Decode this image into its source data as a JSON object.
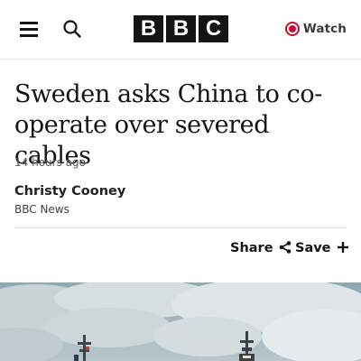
{
  "header": {
    "menu_icon": "hamburger-menu-icon",
    "search_icon": "search-icon",
    "logo_letters": [
      "B",
      "B",
      "C"
    ],
    "watch_label": "Watch",
    "watch_icon": "live-record-icon",
    "accent_color": "#c8102e"
  },
  "article": {
    "headline": "Sweden asks China to co-operate over severed cables",
    "timestamp": "14 hours ago",
    "author": {
      "name": "Christy Cooney",
      "source": "BBC News"
    },
    "actions": {
      "share_label": "Share",
      "share_icon": "share-icon",
      "save_label": "Save",
      "save_icon": "plus-icon"
    },
    "hero_image": "ship-at-sea-under-cloudy-sky"
  }
}
